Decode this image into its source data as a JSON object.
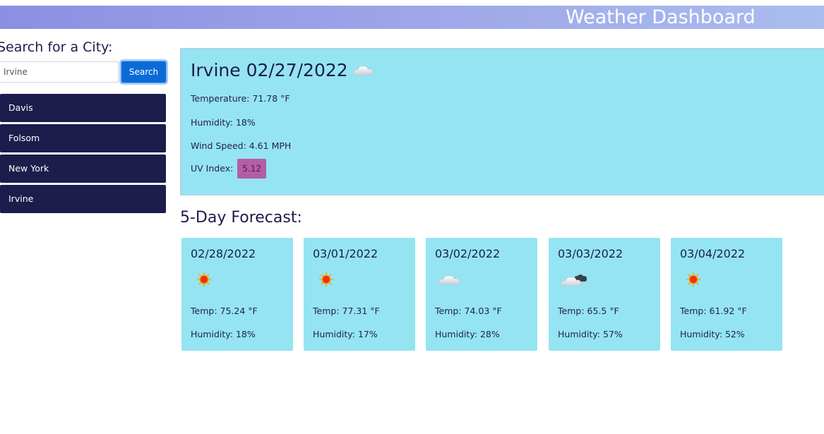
{
  "header": {
    "title": "Weather Dashboard"
  },
  "search": {
    "label": "Search for a City:",
    "value": "Irvine",
    "button_label": "Search"
  },
  "history": [
    {
      "label": "Davis"
    },
    {
      "label": "Folsom"
    },
    {
      "label": "New York"
    },
    {
      "label": "Irvine"
    }
  ],
  "current": {
    "title": "Irvine 02/27/2022",
    "icon": "cloud-icon",
    "temperature": "Temperature: 71.78 °F",
    "humidity": "Humidity: 18%",
    "wind": "Wind Speed: 4.61 MPH",
    "uv_label": "UV Index:",
    "uv_value": "5.12",
    "uv_color": "#b45ea6"
  },
  "forecast": {
    "title": "5-Day Forecast:",
    "days": [
      {
        "date": "02/28/2022",
        "icon": "sun-icon",
        "temp": "Temp: 75.24 °F",
        "humidity": "Humidity: 18%"
      },
      {
        "date": "03/01/2022",
        "icon": "sun-icon",
        "temp": "Temp: 77.31 °F",
        "humidity": "Humidity: 17%"
      },
      {
        "date": "03/02/2022",
        "icon": "cloud-icon",
        "temp": "Temp: 74.03 °F",
        "humidity": "Humidity: 28%"
      },
      {
        "date": "03/03/2022",
        "icon": "dark-cloud-icon",
        "temp": "Temp: 65.5 °F",
        "humidity": "Humidity: 57%"
      },
      {
        "date": "03/04/2022",
        "icon": "sun-icon",
        "temp": "Temp: 61.92 °F",
        "humidity": "Humidity: 52%"
      }
    ]
  },
  "colors": {
    "header_gradient_start": "#8b8fe2",
    "header_gradient_end": "#aabdee",
    "history_item_bg": "#1d1d4b",
    "card_bg": "#95e4f2",
    "search_button_bg": "#0b6bd6"
  }
}
